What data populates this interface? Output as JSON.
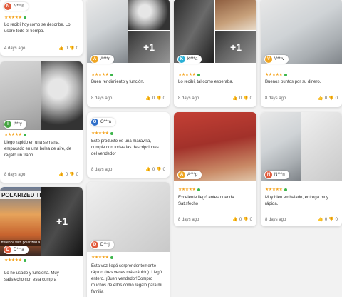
{
  "colors": {
    "star": "#f5a623",
    "verified": "#3cb54a"
  },
  "reviews": [
    {
      "user": "N***n",
      "avatar": "N",
      "avatar_color": "#e15b3c",
      "stars": "★★★★★",
      "text": "Lo recibí hoy,como se describe. Lo usaré todo el tiempo.",
      "date": "4 days ago",
      "likes": "0",
      "dislikes": "0"
    },
    {
      "user": "A***r",
      "avatar": "A",
      "avatar_color": "#f0a623",
      "stars": "★★★★★",
      "extra_photos": "+1",
      "text": "Buen rendimiento y función.",
      "date": "8 days ago",
      "likes": "0",
      "dislikes": "0"
    },
    {
      "user": "K***a",
      "avatar": "K",
      "avatar_color": "#2ab0d6",
      "stars": "★★★★★",
      "extra_photos": "+1",
      "text": "Lo recibí, tal como esperaba.",
      "date": "8 days ago",
      "likes": "0",
      "dislikes": "0"
    },
    {
      "user": "V***v",
      "avatar": "V",
      "avatar_color": "#f0a623",
      "stars": "★★★★★",
      "text": "Buenos puntos por su dinero.",
      "date": "8 days ago",
      "likes": "0",
      "dislikes": "0"
    },
    {
      "user": "I***y",
      "avatar": "I",
      "avatar_color": "#44a340",
      "stars": "★★★★★",
      "text": "Llegó rápido en una semana, empacado en una bolsa de aire, de regalo un trapo.",
      "date": "8 days ago",
      "likes": "0",
      "dislikes": "0"
    },
    {
      "user": "O***a",
      "avatar": "O",
      "avatar_color": "#2f6fc9",
      "stars": "★★★★★",
      "text": "Este producto es una maravilla, cumple con todas las descripciones del vendedor",
      "date": "8 days ago",
      "likes": "0",
      "dislikes": "0"
    },
    {
      "user": "A***p",
      "avatar": "A",
      "avatar_color": "#f0a623",
      "stars": "★★★★★",
      "text": "Excelente llegó antes querida. Satisfecho",
      "date": "8 days ago",
      "likes": "0",
      "dislikes": "0"
    },
    {
      "user": "N***n",
      "avatar": "N",
      "avatar_color": "#e15b3c",
      "stars": "★★★★★",
      "text": "Muy bien embalado, entrega muy rápida.",
      "date": "8 days ago",
      "likes": "0",
      "dislikes": "0"
    },
    {
      "user": "D***a",
      "avatar": "D",
      "avatar_color": "#e15b3c",
      "stars": "★★★★★",
      "extra_photos": "+1",
      "photo_text_1": "POLARIZED TEST",
      "photo_text_2": "fference with polarized a",
      "text": "Lo he usado y funciona. Muy satisfecho con esta compra",
      "date": "",
      "likes": "",
      "dislikes": ""
    },
    {
      "user": "D***j",
      "avatar": "D",
      "avatar_color": "#e15b3c",
      "stars": "★★★★★",
      "text": "Esta vez llegó sorprendentemente rápido (tres veces más rápido). Llegó entero. ¡Buen vendedor!Compro muchos de ellos como regalo para mi familia",
      "date": "",
      "likes": "",
      "dislikes": ""
    }
  ],
  "icons": {
    "like": "thumb-up-icon",
    "dislike": "thumb-down-icon",
    "verified": "verified-dot-icon"
  }
}
